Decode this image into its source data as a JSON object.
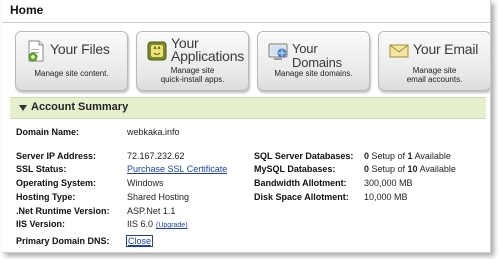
{
  "page": {
    "title": "Home"
  },
  "tiles": [
    {
      "title": "Your Files",
      "desc_line1": "Manage site content.",
      "desc_line2": "",
      "icon": "files-icon"
    },
    {
      "title_line1": "Your",
      "title_line2": "Applications",
      "desc_line1": "Manage site",
      "desc_line2": "quick-install apps.",
      "icon": "applications-icon"
    },
    {
      "title": "Your Domains",
      "desc_line1": "Manage site domains.",
      "desc_line2": "",
      "icon": "domains-icon"
    },
    {
      "title": "Your Email",
      "desc_line1": "Manage site",
      "desc_line2": "email accounts.",
      "icon": "email-icon"
    }
  ],
  "account_summary": {
    "heading": "Account Summary",
    "domain_name": {
      "label": "Domain Name:",
      "value": "webkaka.info"
    },
    "left": [
      {
        "label": "Server IP Address:",
        "value": "72.167.232.62"
      },
      {
        "label": "SSL Status:",
        "value": "Purchase SSL Certificate"
      },
      {
        "label": "Operating System:",
        "value": "Windows"
      },
      {
        "label": "Hosting Type:",
        "value": "Shared Hosting"
      },
      {
        "label": ".Net Runtime Version:",
        "value": "ASP.Net 1.1"
      },
      {
        "label": "IIS Version:",
        "value": "IIS 6.0",
        "link": "(Upgrade)"
      }
    ],
    "right": [
      {
        "label": "SQL Server Databases:",
        "count": "0",
        "mid": " Setup of ",
        "total": "1",
        "suffix": " Available"
      },
      {
        "label": "MySQL Databases:",
        "count": "0",
        "mid": " Setup of ",
        "total": "10",
        "suffix": " Available"
      },
      {
        "label": "Bandwidth Allotment:",
        "value": "300,000 MB"
      },
      {
        "label": "Disk Space Allotment:",
        "value": "10,000 MB"
      }
    ],
    "primary_dns": {
      "label": "Primary Domain DNS:",
      "value": "Close"
    }
  },
  "colors": {
    "section_bg": "#e6f0cf",
    "link": "#1f3fb0"
  }
}
